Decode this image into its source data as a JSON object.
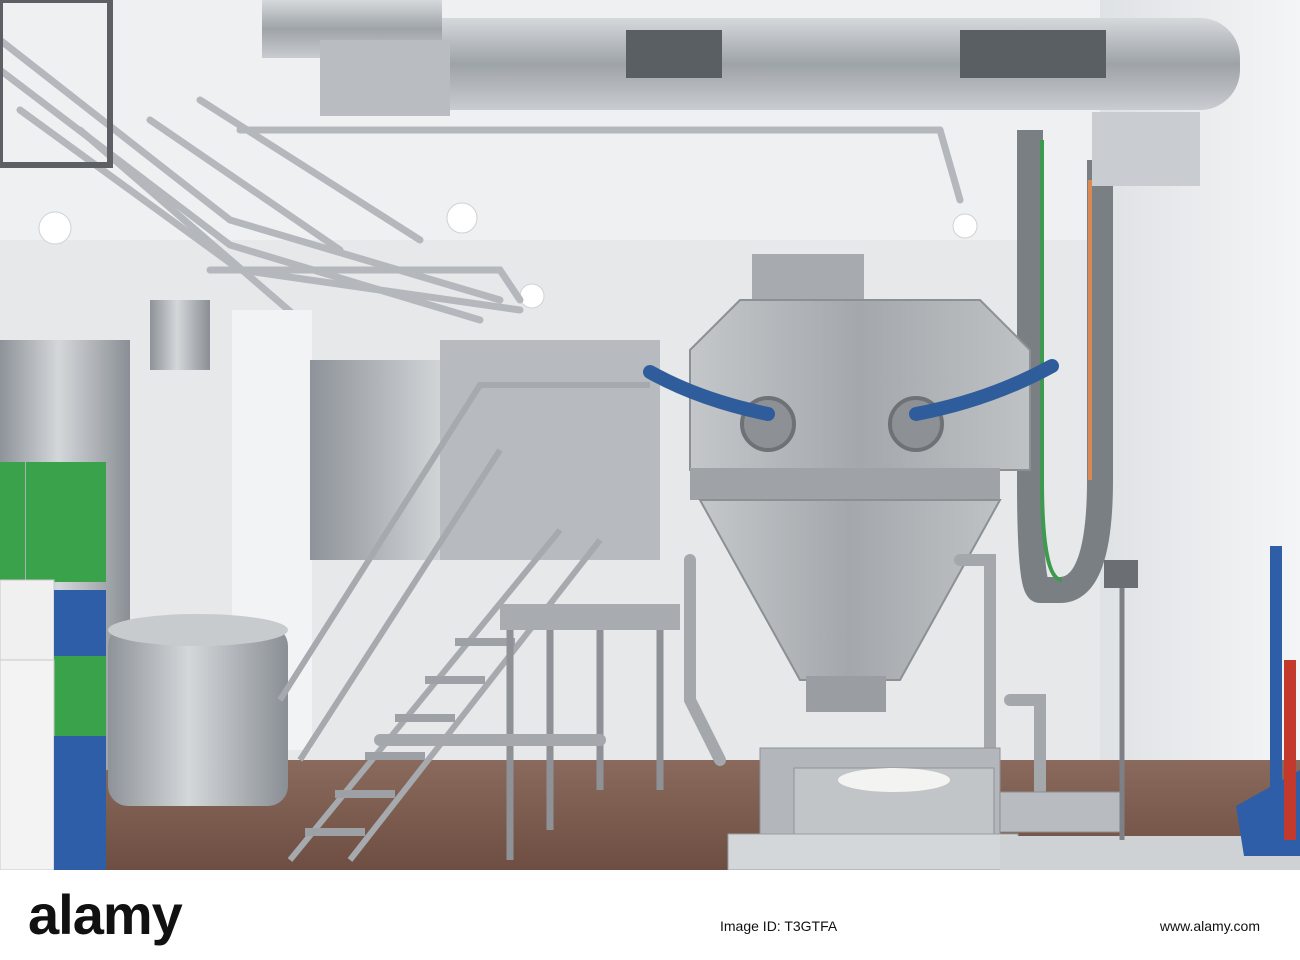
{
  "photo": {
    "subject": "Industrial dairy / food production hall with stainless steel hopper, tanks, piping and stairs",
    "colors": {
      "wall": "#eceef0",
      "ceiling": "#f2f3f4",
      "steel": "#9aa0a6",
      "floor": "#7a5a4c",
      "crate_green": "#3aa24a",
      "crate_blue": "#2f5ea8",
      "hose_blue": "#2f5d9c"
    }
  },
  "footer": {
    "logo": "alamy",
    "image_id": "Image ID: T3GTFA",
    "url": "www.alamy.com"
  }
}
